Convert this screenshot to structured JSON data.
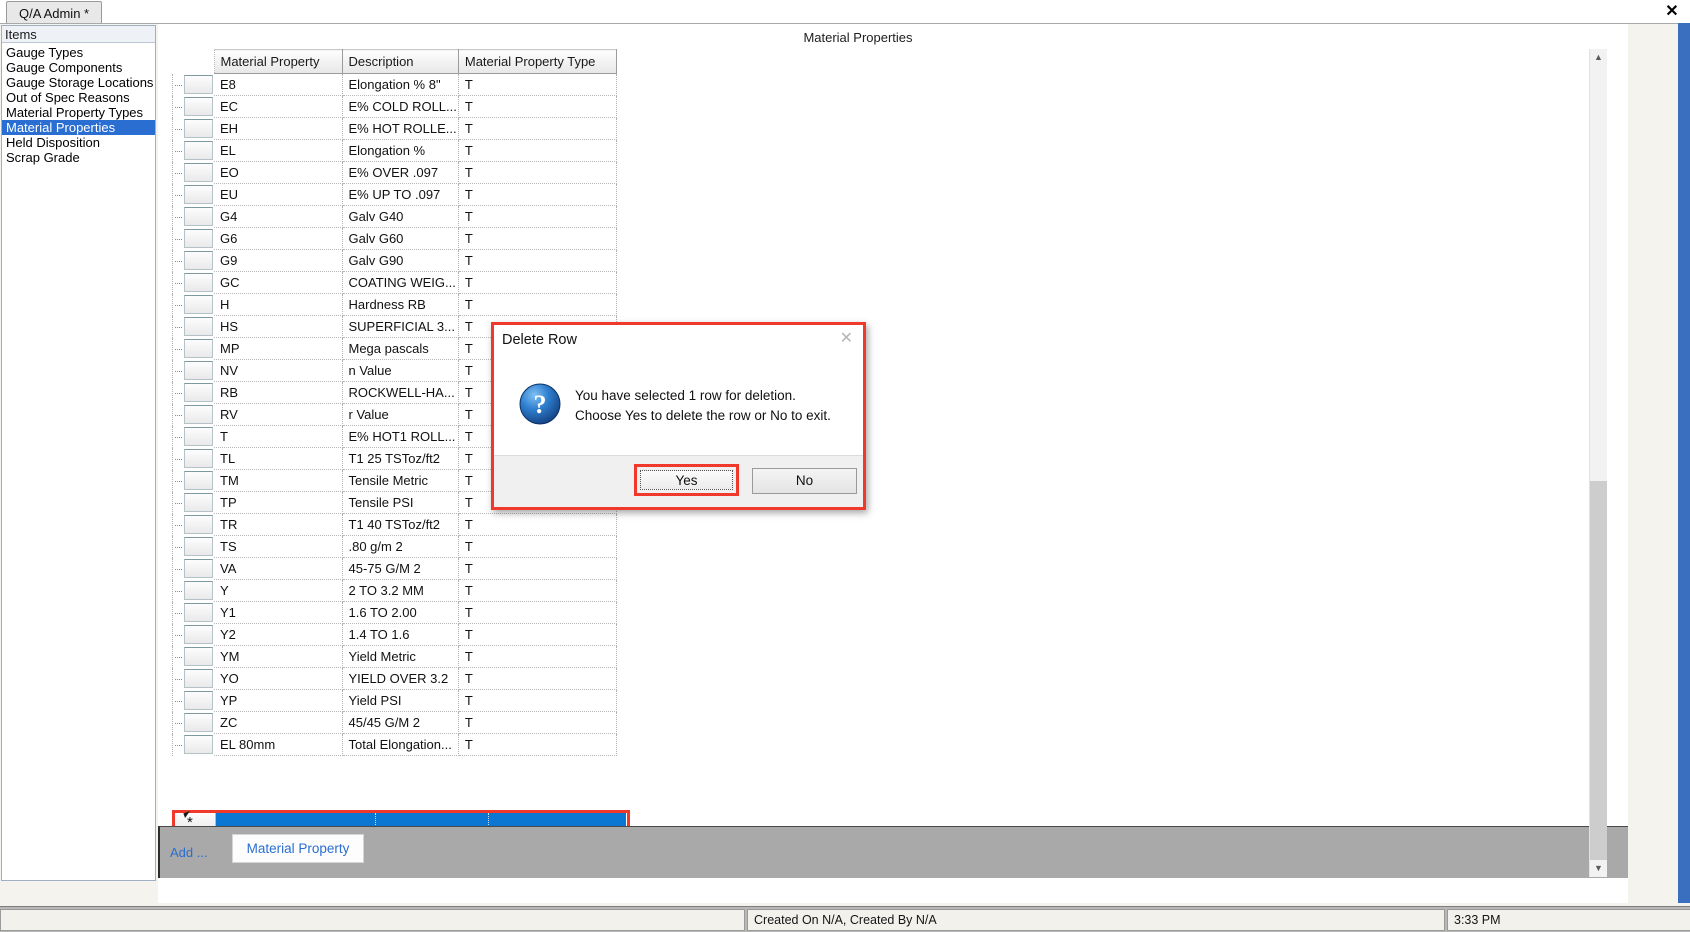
{
  "window": {
    "tab_label": "Q/A Admin *",
    "close_icon": "close-x"
  },
  "sidebar": {
    "header": "Items",
    "items": [
      {
        "label": "Gauge Types",
        "selected": false
      },
      {
        "label": "Gauge Components",
        "selected": false
      },
      {
        "label": "Gauge Storage Locations",
        "selected": false
      },
      {
        "label": "Out of Spec Reasons",
        "selected": false
      },
      {
        "label": "Material Property Types",
        "selected": false
      },
      {
        "label": "Material Properties",
        "selected": true
      },
      {
        "label": "Held Disposition",
        "selected": false
      },
      {
        "label": "Scrap Grade",
        "selected": false
      }
    ],
    "selected_color": "#2a6ed2"
  },
  "main": {
    "title": "Material Properties",
    "grid": {
      "columns": [
        "Material Property",
        "Description",
        "Material Property Type"
      ],
      "rows": [
        [
          "E8",
          "Elongation % 8\"",
          "T"
        ],
        [
          "EC",
          "E% COLD ROLL...",
          "T"
        ],
        [
          "EH",
          "E% HOT ROLLE...",
          "T"
        ],
        [
          "EL",
          "Elongation %",
          "T"
        ],
        [
          "EO",
          "E% OVER .097",
          "T"
        ],
        [
          "EU",
          "E% UP TO .097",
          "T"
        ],
        [
          "G4",
          "Galv G40",
          "T"
        ],
        [
          "G6",
          "Galv G60",
          "T"
        ],
        [
          "G9",
          "Galv G90",
          "T"
        ],
        [
          "GC",
          "COATING WEIG...",
          "T"
        ],
        [
          "H",
          "Hardness RB",
          "T"
        ],
        [
          "HS",
          "SUPERFICIAL  3...",
          "T"
        ],
        [
          "MP",
          "Mega pascals",
          "T"
        ],
        [
          "NV",
          "n Value",
          "T"
        ],
        [
          "RB",
          "ROCKWELL-HA...",
          "T"
        ],
        [
          "RV",
          "r Value",
          "T"
        ],
        [
          "T",
          "E% HOT1 ROLL...",
          "T"
        ],
        [
          "TL",
          "T1 25 TSToz/ft2",
          "T"
        ],
        [
          "TM",
          "Tensile Metric",
          "T"
        ],
        [
          "TP",
          "Tensile PSI",
          "T"
        ],
        [
          "TR",
          "T1 40 TSToz/ft2",
          "T"
        ],
        [
          "TS",
          ".80 g/m 2",
          "T"
        ],
        [
          "VA",
          "45-75 G/M 2",
          "T"
        ],
        [
          "Y",
          "2 TO 3.2 MM",
          "T"
        ],
        [
          "Y1",
          "1.6 TO 2.00",
          "T"
        ],
        [
          "Y2",
          "1.4 TO 1.6",
          "T"
        ],
        [
          "YM",
          "Yield Metric",
          "T"
        ],
        [
          "YO",
          "YIELD OVER 3.2",
          "T"
        ],
        [
          "YP",
          "Yield PSI",
          "T"
        ],
        [
          "ZC",
          "45/45 G/M 2",
          "T"
        ],
        [
          "EL 80mm",
          "Total  Elongation...",
          "T"
        ]
      ],
      "new_row": {
        "marker": "*",
        "highlight_color": "#0b77d2",
        "outline_color": "#f0392b"
      }
    },
    "addbar": {
      "add_label": "Add ...",
      "add_button": "Material Property"
    }
  },
  "dialog": {
    "title": "Delete Row",
    "close_icon": "close-x",
    "icon": "question-icon",
    "message_line1": "You have selected 1 row for deletion.",
    "message_line2": "Choose Yes to delete the row or No to exit.",
    "yes_label": "Yes",
    "no_label": "No",
    "focus_outline_color": "#f0392b"
  },
  "statusbar": {
    "left": "",
    "middle": "Created On N/A, Created By N/A",
    "right": "3:33 PM"
  }
}
